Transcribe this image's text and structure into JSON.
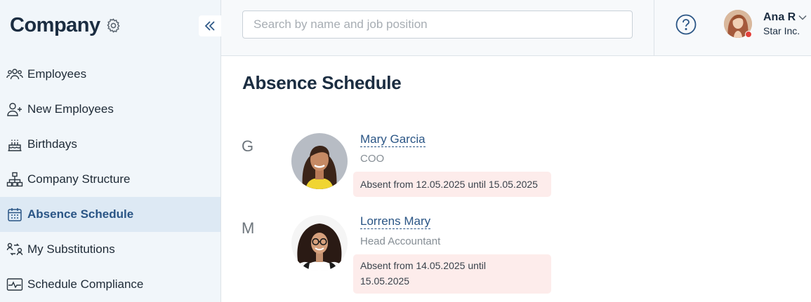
{
  "sidebar": {
    "title": "Company",
    "items": [
      {
        "label": "Employees",
        "icon": "employees-icon",
        "active": false
      },
      {
        "label": "New Employees",
        "icon": "add-person-icon",
        "active": false
      },
      {
        "label": "Birthdays",
        "icon": "cake-icon",
        "active": false
      },
      {
        "label": "Company Structure",
        "icon": "org-structure-icon",
        "active": false
      },
      {
        "label": "Absence Schedule",
        "icon": "calendar-icon",
        "active": true
      },
      {
        "label": "My Substitutions",
        "icon": "substitution-icon",
        "active": false
      },
      {
        "label": "Schedule Compliance",
        "icon": "pulse-icon",
        "active": false
      }
    ]
  },
  "header": {
    "search_placeholder": "Search by name and job position",
    "search_value": "",
    "user": {
      "name": "Ana R",
      "company": "Star Inc."
    }
  },
  "main": {
    "title": "Absence Schedule",
    "groups": [
      {
        "letter": "G",
        "employees": [
          {
            "name": "Mary Garcia",
            "position": "COO",
            "absence_line1": "Absent from 12.05.2025 until 15.05.2025",
            "absence_line2": ""
          }
        ]
      },
      {
        "letter": "M",
        "employees": [
          {
            "name": "Lorrens Mary",
            "position": "Head Accountant",
            "absence_line1": "Absent from 14.05.2025 until",
            "absence_line2": "15.05.2025"
          }
        ]
      }
    ]
  },
  "colors": {
    "sidebar_bg": "#f1f6fa",
    "active_item_bg": "#dde9f4",
    "accent": "#2a5585",
    "absence_bg": "#fdeceb",
    "status_dot": "#e2413b"
  }
}
